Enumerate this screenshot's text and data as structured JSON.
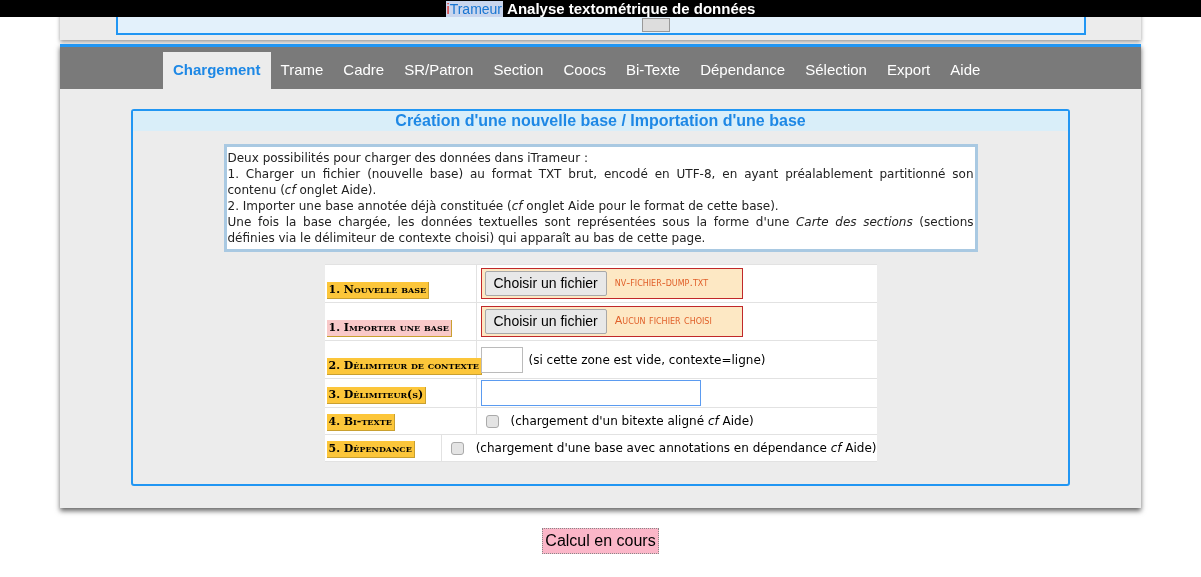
{
  "title_bar": {
    "logo_accent": "i",
    "logo_rest": "Trameur",
    "title": "Analyse textométrique de données"
  },
  "tabs": [
    {
      "label": "Chargement",
      "selected": true
    },
    {
      "label": "Trame",
      "selected": false
    },
    {
      "label": "Cadre",
      "selected": false
    },
    {
      "label": "SR/Patron",
      "selected": false
    },
    {
      "label": "Section",
      "selected": false
    },
    {
      "label": "Coocs",
      "selected": false
    },
    {
      "label": "Bi-Texte",
      "selected": false
    },
    {
      "label": "Dépendance",
      "selected": false
    },
    {
      "label": "Sélection",
      "selected": false
    },
    {
      "label": "Export",
      "selected": false
    },
    {
      "label": "Aide",
      "selected": false
    }
  ],
  "section_title": "Création d'une nouvelle base / Importation d'une base",
  "description": [
    "Deux possibilités pour charger des données dans iTrameur :",
    "1. Charger un fichier (nouvelle base) au format TXT brut, encodé en UTF-8, en ayant préalablement partitionné son contenu (*cf* onglet Aide).",
    "2. Importer une base annotée déjà constituée (*cf* onglet Aide pour le format de cette base).",
    "Une fois la base chargée, les données textuelles sont représentées sous la forme d'une *Carte des sections* (sections définies via le délimiteur de contexte choisi) qui apparaît au bas de cette page."
  ],
  "form_rows": [
    {
      "kind": "file",
      "label": "1. Nouvelle base",
      "color": "#fcc63a",
      "button": "Choisir un fichier",
      "file_name": "nv-fichier-dump.txt"
    },
    {
      "kind": "file",
      "label": "1. Importer une base",
      "color": "#f9c9c9",
      "button": "Choisir un fichier",
      "file_name": "Aucun fichier choisi"
    },
    {
      "kind": "small_input",
      "label": "2. Délimiteur de contexte",
      "color": "#fcc63a",
      "hint": "(si cette zone est vide, contexte=ligne)"
    },
    {
      "kind": "input",
      "label": "3. Délimiteur(s)",
      "color": "#fcc63a",
      "focused": true
    },
    {
      "kind": "checkbox",
      "label": "4. Bi-texte",
      "color": "#fcc63a",
      "checked": false,
      "hint": "(chargement d'un bitexte aligné *cf* Aide)"
    },
    {
      "kind": "checkbox",
      "label": "5. Dépendance",
      "color": "#fcc63a",
      "checked": false,
      "hint": "(chargement d'une base avec annotations en dépendance *cf* Aide)"
    }
  ],
  "status": "Calcul en cours"
}
